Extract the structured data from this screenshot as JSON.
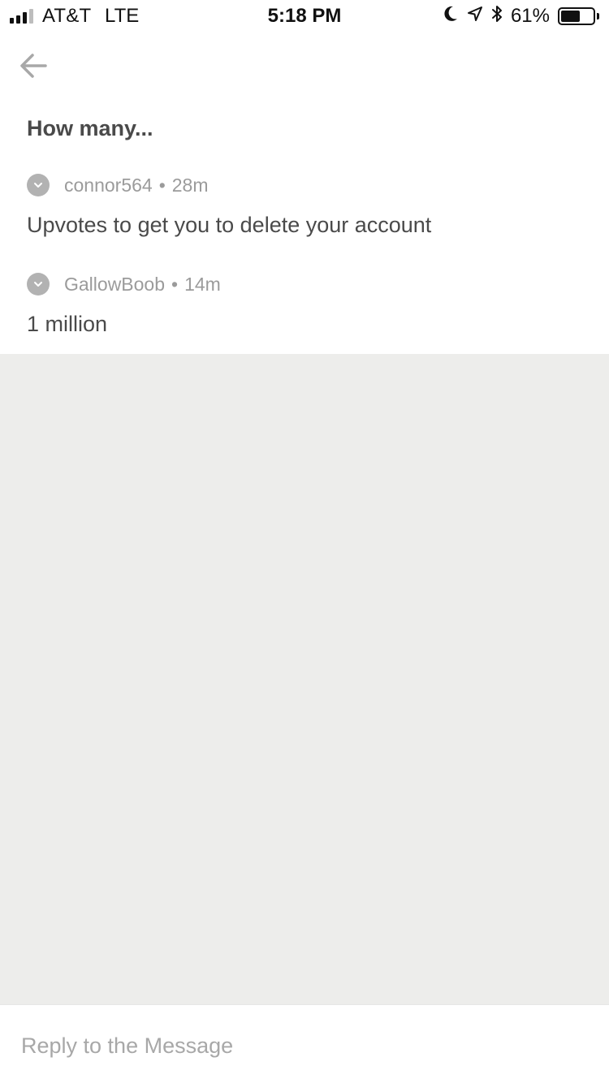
{
  "status_bar": {
    "carrier": "AT&T",
    "network": "LTE",
    "time": "5:18 PM",
    "battery_percent": "61%",
    "battery_level": 0.61,
    "icons": [
      "signal-icon",
      "moon-icon",
      "location-arrow-icon",
      "bluetooth-icon",
      "battery-icon"
    ]
  },
  "nav": {
    "back_icon": "arrow-left-icon"
  },
  "thread": {
    "title": "How many...",
    "messages": [
      {
        "author": "connor564",
        "separator": "•",
        "time": "28m",
        "body": "Upvotes to get you to delete your account"
      },
      {
        "author": "GallowBoob",
        "separator": "•",
        "time": "14m",
        "body": "1 million"
      }
    ]
  },
  "reply": {
    "placeholder": "Reply to the Message",
    "value": ""
  },
  "colors": {
    "text_primary": "#4a4a4a",
    "text_secondary": "#9b9b9b",
    "empty_area": "#ededeb"
  }
}
